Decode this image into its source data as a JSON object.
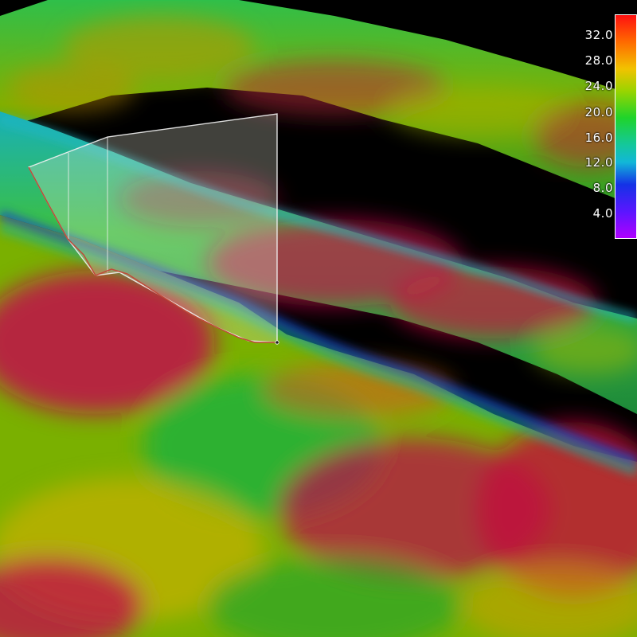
{
  "colorbar": {
    "ticks": [
      "32.0",
      "28.0",
      "24.0",
      "20.0",
      "16.0",
      "12.0",
      "8.0",
      "4.0"
    ],
    "colors": [
      "#ff1010",
      "#ff6a00",
      "#f2c200",
      "#9ad400",
      "#1fd42a",
      "#14c89a",
      "#12b7d8",
      "#1432e6",
      "#5a16ff",
      "#b000ff"
    ]
  },
  "scene": {
    "background": "#000000",
    "surface_palette": [
      "#c0104a",
      "#b01a3a",
      "#6fa800",
      "#2fb02a",
      "#16a0a0",
      "#2040c0",
      "#c8b000",
      "#d06020"
    ]
  }
}
